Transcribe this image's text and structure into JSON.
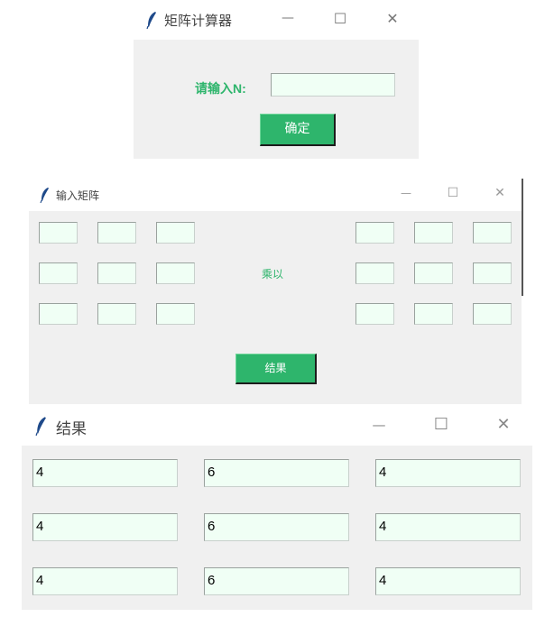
{
  "window1": {
    "title": "矩阵计算器",
    "label": "请输入N:",
    "input_value": "",
    "button": "确定",
    "controls": {
      "minimize": "—",
      "maximize": "☐",
      "close": "✕"
    }
  },
  "window2": {
    "title": "输入矩阵",
    "operator": "乘以",
    "button": "结果",
    "matrix_a": [
      [
        "",
        "",
        ""
      ],
      [
        "",
        "",
        ""
      ],
      [
        "",
        "",
        ""
      ]
    ],
    "matrix_b": [
      [
        "",
        "",
        ""
      ],
      [
        "",
        "",
        ""
      ],
      [
        "",
        "",
        ""
      ]
    ],
    "controls": {
      "minimize": "—",
      "maximize": "☐",
      "close": "✕"
    }
  },
  "window3": {
    "title": "结果",
    "values": [
      [
        "4",
        "6",
        "4"
      ],
      [
        "4",
        "6",
        "4"
      ],
      [
        "4",
        "6",
        "4"
      ]
    ],
    "controls": {
      "minimize": "—",
      "maximize": "☐",
      "close": "✕"
    }
  },
  "colors": {
    "accent": "#2eb56c",
    "entry_bg": "#f0fff5",
    "client_bg": "#f0f0f0"
  },
  "icons": {
    "app": "feather-icon"
  }
}
